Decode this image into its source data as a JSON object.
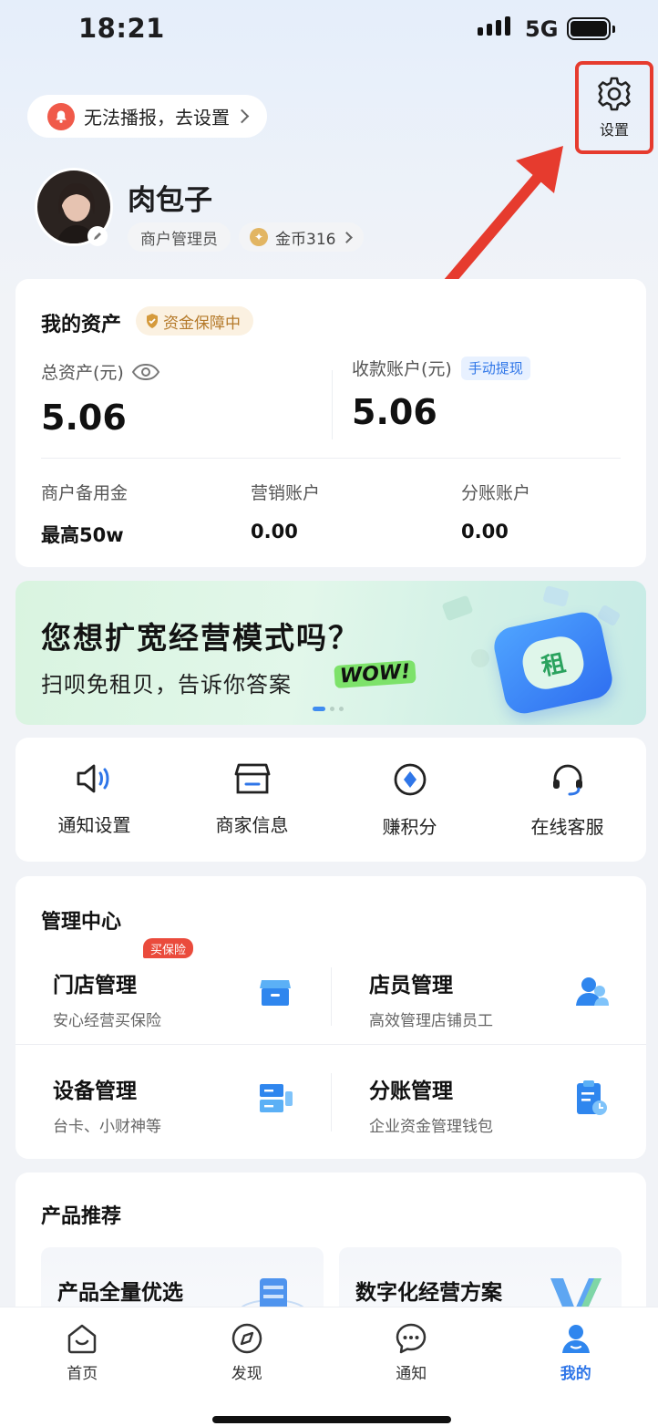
{
  "status_bar": {
    "time": "18:21",
    "network": "5G"
  },
  "notice": {
    "text": "无法播报，去设置"
  },
  "settings": {
    "label": "设置"
  },
  "profile": {
    "name": "肉包子",
    "role": "商户管理员",
    "coins": "金币316"
  },
  "assets": {
    "title": "我的资产",
    "badge": "资金保障中",
    "total_label": "总资产(元)",
    "total_value": "5.06",
    "receive_label": "收款账户(元)",
    "withdraw_tag": "手动提现",
    "receive_value": "5.06",
    "sub": [
      {
        "label": "商户备用金",
        "value": "最高50w"
      },
      {
        "label": "营销账户",
        "value": "0.00"
      },
      {
        "label": "分账账户",
        "value": "0.00"
      }
    ]
  },
  "banner": {
    "title": "您想扩宽经营模式吗？",
    "subtitle": "扫呗免租贝，告诉你答案",
    "wow": "WOW!",
    "icon_text": "租"
  },
  "quick": [
    {
      "label": "通知设置",
      "icon": "speaker-icon"
    },
    {
      "label": "商家信息",
      "icon": "store-icon"
    },
    {
      "label": "赚积分",
      "icon": "points-icon"
    },
    {
      "label": "在线客服",
      "icon": "headset-icon"
    }
  ],
  "management": {
    "title": "管理中心",
    "hot_tag": "买保险",
    "items": [
      {
        "title": "门店管理",
        "desc": "安心经营买保险",
        "icon": "store-box-icon"
      },
      {
        "title": "店员管理",
        "desc": "高效管理店铺员工",
        "icon": "staff-icon"
      },
      {
        "title": "设备管理",
        "desc": "台卡、小财神等",
        "icon": "device-icon"
      },
      {
        "title": "分账管理",
        "desc": "企业资金管理钱包",
        "icon": "ledger-icon"
      }
    ]
  },
  "products": {
    "title": "产品推荐",
    "items": [
      {
        "title": "产品全量优选"
      },
      {
        "title": "数字化经营方案"
      }
    ]
  },
  "tabs": [
    {
      "label": "首页",
      "icon": "home-icon"
    },
    {
      "label": "发现",
      "icon": "compass-icon"
    },
    {
      "label": "通知",
      "icon": "chat-icon"
    },
    {
      "label": "我的",
      "icon": "user-icon",
      "active": true
    }
  ],
  "colors": {
    "accent": "#2f76e8",
    "highlight": "#e63b2e"
  }
}
